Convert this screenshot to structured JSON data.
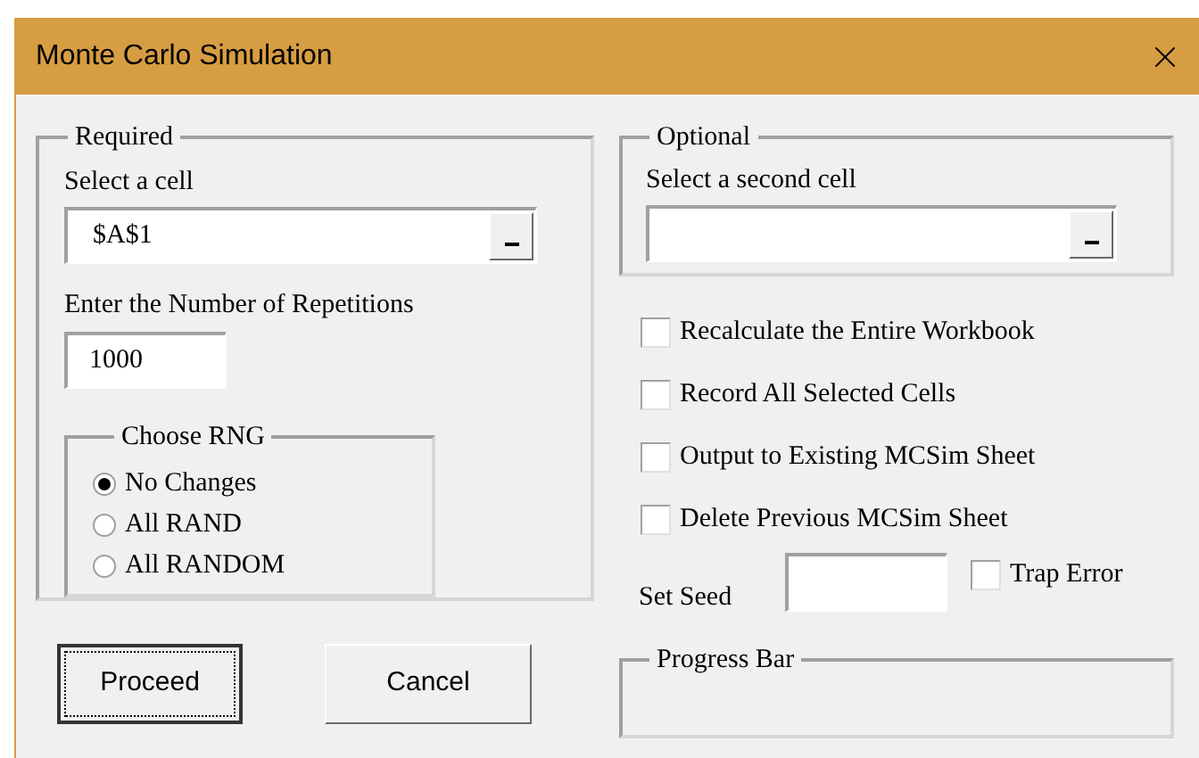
{
  "window": {
    "title": "Monte Carlo Simulation"
  },
  "required": {
    "label": "Required",
    "cell_label": "Select a cell",
    "cell_value": "$A$1",
    "repetitions_label": "Enter the Number of Repetitions",
    "repetitions_value": "1000",
    "rng": {
      "label": "Choose RNG",
      "options": [
        {
          "label": "No Changes",
          "selected": true
        },
        {
          "label": "All RAND",
          "selected": false
        },
        {
          "label": "All RANDOM",
          "selected": false
        }
      ]
    }
  },
  "optional": {
    "label": "Optional",
    "cell_label": "Select a second cell"
  },
  "checkboxes": [
    {
      "label": "Recalculate the Entire Workbook",
      "checked": false
    },
    {
      "label": "Record All Selected Cells",
      "checked": false
    },
    {
      "label": "Output to Existing MCSim Sheet",
      "checked": false
    },
    {
      "label": "Delete Previous MCSim Sheet",
      "checked": false
    }
  ],
  "seed": {
    "label": "Set Seed"
  },
  "trap_error": {
    "label": "Trap Error",
    "checked": false
  },
  "progress_bar": {
    "label": "Progress Bar"
  },
  "buttons": [
    {
      "label": "Proceed",
      "focused": true
    },
    {
      "label": "Cancel",
      "focused": false
    }
  ]
}
